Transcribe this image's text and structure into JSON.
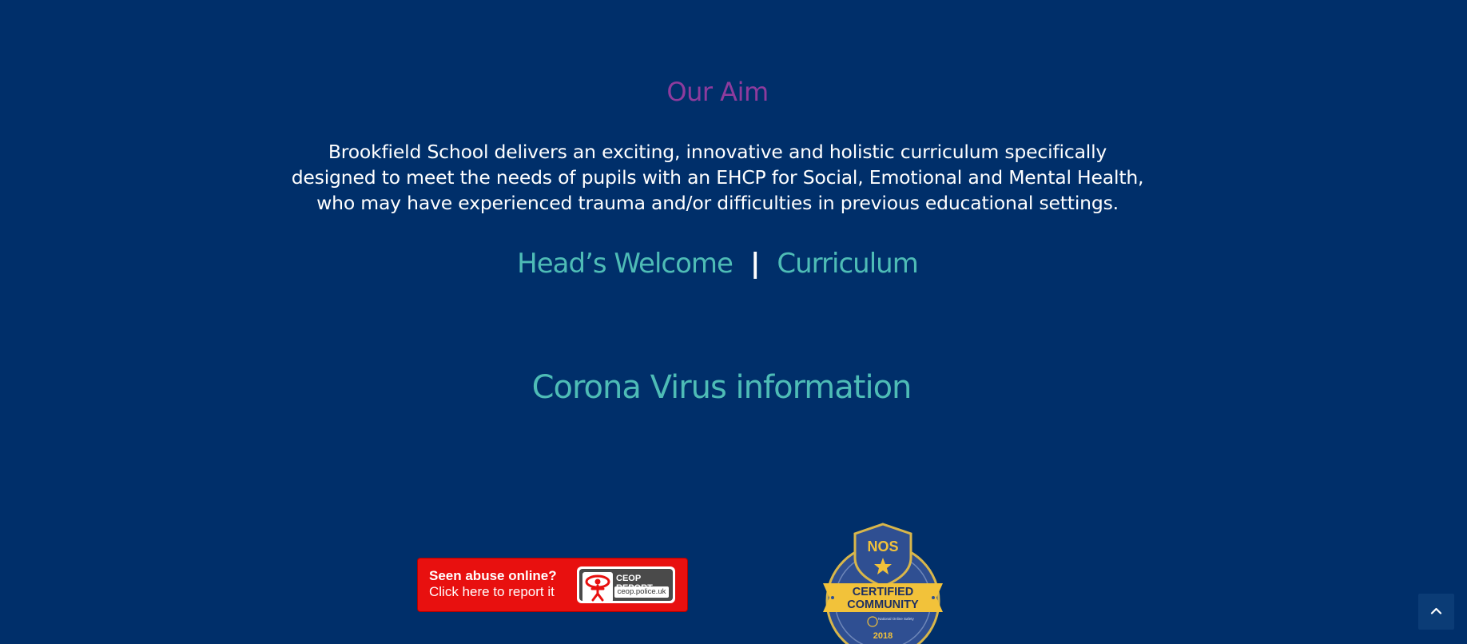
{
  "aim": {
    "title": "Our Aim",
    "text": "Brookfield School delivers an exciting, innovative and holistic curriculum specifically designed to meet the needs of pupils with an EHCP for Social, Emotional and Mental Health, who may have experienced trauma and/or difficulties in previous educational settings."
  },
  "links": {
    "heads_welcome": "Head’s Welcome",
    "separator": "|",
    "curriculum": "Curriculum"
  },
  "corona": {
    "label": "Corona Virus information"
  },
  "ceop_banner": {
    "line1": "Seen abuse online?",
    "line2": "Click here to report it",
    "badge_title": "CEOP REPORT",
    "badge_url": "ceop.police.uk"
  },
  "nos_badge": {
    "top_text": "NOS",
    "ribbon_line1": "CERTIFIED",
    "ribbon_line2": "COMMUNITY",
    "small_text": "National Online Safety",
    "year": "2018"
  },
  "back_to_top": {
    "icon": "chevron-up-icon"
  },
  "colors": {
    "background": "#002f6a",
    "aim_title": "#8e3b9d",
    "link": "#4ebcb6",
    "ceop_red": "#e8100f",
    "nos_gold": "#f2c23a"
  }
}
